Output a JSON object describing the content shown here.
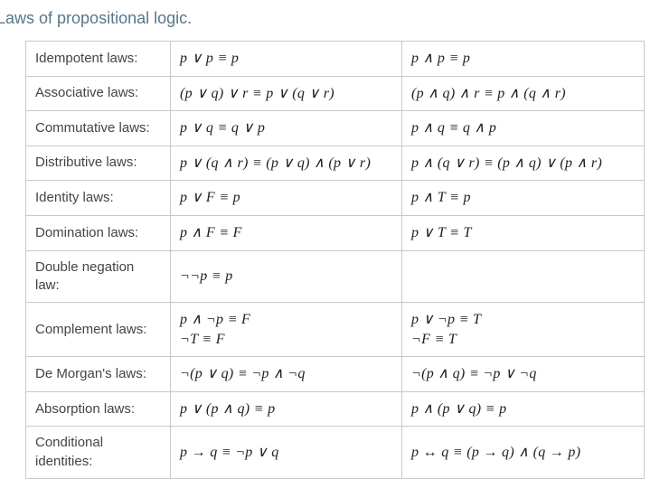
{
  "title": "Laws of propositional logic.",
  "laws": {
    "idempotent": {
      "label": "Idempotent laws:",
      "eq1": "p ∨ p ≡ p",
      "eq2": "p ∧ p ≡ p"
    },
    "associative": {
      "label": "Associative laws:",
      "eq1": "(p ∨ q) ∨ r ≡ p ∨ (q ∨ r)",
      "eq2": "(p ∧ q) ∧ r ≡ p ∧ (q ∧ r)"
    },
    "commutative": {
      "label": "Commutative laws:",
      "eq1": "p ∨ q ≡ q ∨ p",
      "eq2": "p ∧ q ≡ q ∧ p"
    },
    "distributive": {
      "label": "Distributive laws:",
      "eq1": "p ∨ (q ∧ r) ≡ (p ∨ q) ∧ (p ∨ r)",
      "eq2": "p ∧ (q ∨ r) ≡ (p ∧ q) ∨ (p ∧ r)"
    },
    "identity": {
      "label": "Identity laws:",
      "eq1": "p ∨ F ≡ p",
      "eq2": "p ∧ T ≡ p"
    },
    "domination": {
      "label": "Domination laws:",
      "eq1": "p ∧ F ≡ F",
      "eq2": "p ∨ T ≡ T"
    },
    "double_negation": {
      "label": "Double negation law:",
      "eq1": "¬¬p ≡ p",
      "eq2": ""
    },
    "complement": {
      "label": "Complement laws:",
      "eq1a": "p ∧ ¬p ≡ F",
      "eq1b": "¬T ≡ F",
      "eq2a": "p ∨ ¬p ≡ T",
      "eq2b": "¬F ≡ T"
    },
    "demorgan": {
      "label": "De Morgan's laws:",
      "eq1": "¬(p ∨ q) ≡ ¬p ∧ ¬q",
      "eq2": "¬(p ∧ q) ≡ ¬p ∨ ¬q"
    },
    "absorption": {
      "label": "Absorption laws:",
      "eq1": "p ∨ (p ∧ q) ≡ p",
      "eq2": "p ∧ (p ∨ q) ≡ p"
    },
    "conditional": {
      "label": "Conditional identities:",
      "eq1": "p → q ≡ ¬p ∨ q",
      "eq2": "p ↔ q ≡ (p → q) ∧ (q → p)"
    }
  }
}
